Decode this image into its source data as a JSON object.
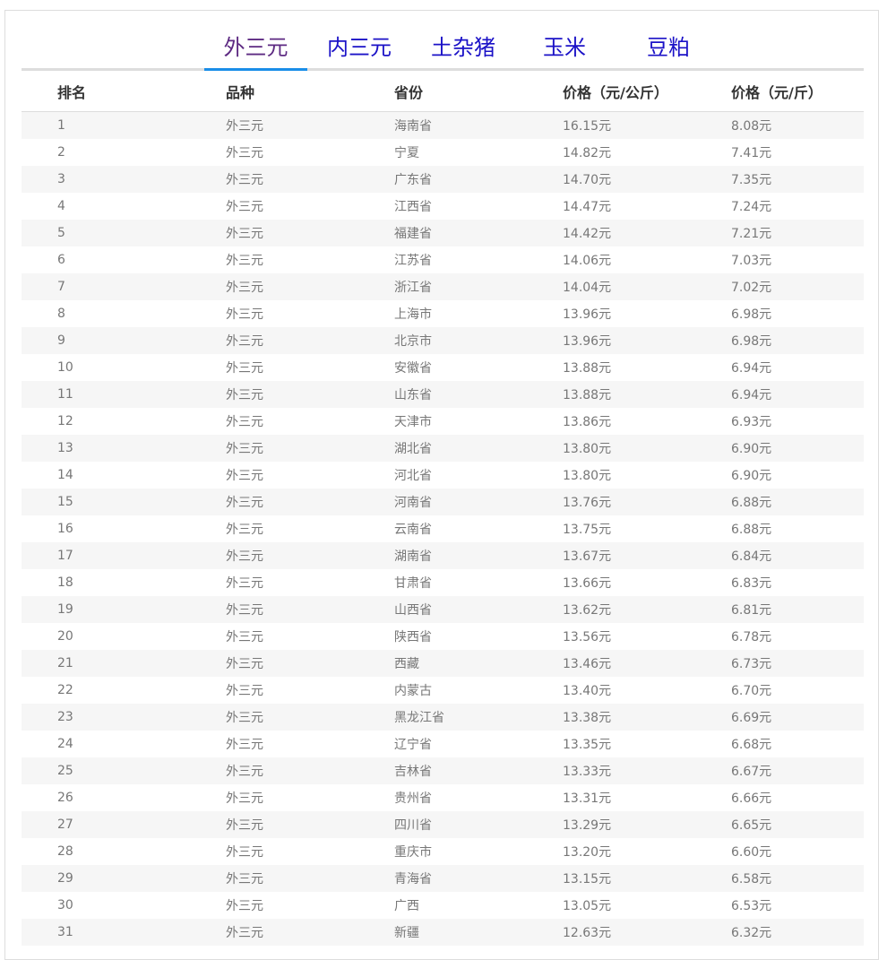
{
  "tabs": [
    {
      "label": "外三元",
      "active": true
    },
    {
      "label": "内三元",
      "active": false
    },
    {
      "label": "土杂猪",
      "active": false
    },
    {
      "label": "玉米",
      "active": false
    },
    {
      "label": "豆粕",
      "active": false
    }
  ],
  "table": {
    "headers": [
      "排名",
      "品种",
      "省份",
      "价格（元/公斤）",
      "价格（元/斤）"
    ],
    "rows": [
      [
        "1",
        "外三元",
        "海南省",
        "16.15元",
        "8.08元"
      ],
      [
        "2",
        "外三元",
        "宁夏",
        "14.82元",
        "7.41元"
      ],
      [
        "3",
        "外三元",
        "广东省",
        "14.70元",
        "7.35元"
      ],
      [
        "4",
        "外三元",
        "江西省",
        "14.47元",
        "7.24元"
      ],
      [
        "5",
        "外三元",
        "福建省",
        "14.42元",
        "7.21元"
      ],
      [
        "6",
        "外三元",
        "江苏省",
        "14.06元",
        "7.03元"
      ],
      [
        "7",
        "外三元",
        "浙江省",
        "14.04元",
        "7.02元"
      ],
      [
        "8",
        "外三元",
        "上海市",
        "13.96元",
        "6.98元"
      ],
      [
        "9",
        "外三元",
        "北京市",
        "13.96元",
        "6.98元"
      ],
      [
        "10",
        "外三元",
        "安徽省",
        "13.88元",
        "6.94元"
      ],
      [
        "11",
        "外三元",
        "山东省",
        "13.88元",
        "6.94元"
      ],
      [
        "12",
        "外三元",
        "天津市",
        "13.86元",
        "6.93元"
      ],
      [
        "13",
        "外三元",
        "湖北省",
        "13.80元",
        "6.90元"
      ],
      [
        "14",
        "外三元",
        "河北省",
        "13.80元",
        "6.90元"
      ],
      [
        "15",
        "外三元",
        "河南省",
        "13.76元",
        "6.88元"
      ],
      [
        "16",
        "外三元",
        "云南省",
        "13.75元",
        "6.88元"
      ],
      [
        "17",
        "外三元",
        "湖南省",
        "13.67元",
        "6.84元"
      ],
      [
        "18",
        "外三元",
        "甘肃省",
        "13.66元",
        "6.83元"
      ],
      [
        "19",
        "外三元",
        "山西省",
        "13.62元",
        "6.81元"
      ],
      [
        "20",
        "外三元",
        "陕西省",
        "13.56元",
        "6.78元"
      ],
      [
        "21",
        "外三元",
        "西藏",
        "13.46元",
        "6.73元"
      ],
      [
        "22",
        "外三元",
        "内蒙古",
        "13.40元",
        "6.70元"
      ],
      [
        "23",
        "外三元",
        "黑龙江省",
        "13.38元",
        "6.69元"
      ],
      [
        "24",
        "外三元",
        "辽宁省",
        "13.35元",
        "6.68元"
      ],
      [
        "25",
        "外三元",
        "吉林省",
        "13.33元",
        "6.67元"
      ],
      [
        "26",
        "外三元",
        "贵州省",
        "13.31元",
        "6.66元"
      ],
      [
        "27",
        "外三元",
        "四川省",
        "13.29元",
        "6.65元"
      ],
      [
        "28",
        "外三元",
        "重庆市",
        "13.20元",
        "6.60元"
      ],
      [
        "29",
        "外三元",
        "青海省",
        "13.15元",
        "6.58元"
      ],
      [
        "30",
        "外三元",
        "广西",
        "13.05元",
        "6.53元"
      ],
      [
        "31",
        "外三元",
        "新疆",
        "12.63元",
        "6.32元"
      ]
    ]
  },
  "colors": {
    "tab_text": "#1b12c7",
    "tab_active_text": "#5d2a82",
    "tab_active_underline": "#1a8ee8",
    "row_stripe": "#f6f6f6"
  }
}
